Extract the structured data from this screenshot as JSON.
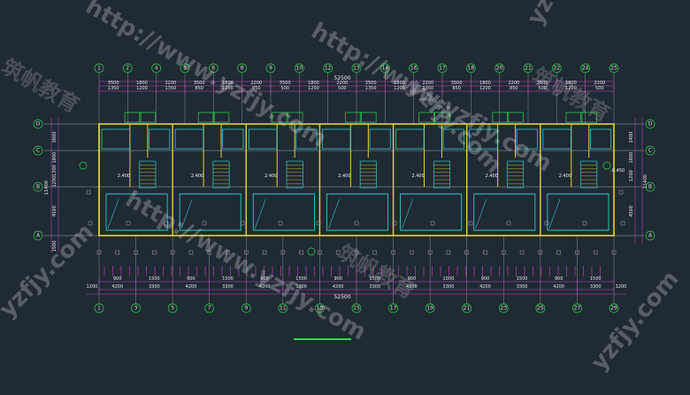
{
  "drawing": {
    "top_axes": [
      "1",
      "2",
      "4",
      "5",
      "6",
      "8",
      "9",
      "10",
      "12",
      "13",
      "14",
      "16",
      "17",
      "18",
      "20",
      "21",
      "22",
      "24",
      "25"
    ],
    "bottom_axes": [
      "1",
      "3",
      "5",
      "7",
      "9",
      "11",
      "13",
      "15",
      "17",
      "19",
      "21",
      "23",
      "25",
      "27",
      "29"
    ],
    "side_axes": [
      "D",
      "C",
      "B",
      "A"
    ],
    "total_length": "52500",
    "top_bays": [
      "3500",
      "1800",
      "2200",
      "3500",
      "1800",
      "2200",
      "3500",
      "1800",
      "2200",
      "3500",
      "1800",
      "2200",
      "3500",
      "1800",
      "2200",
      "3500",
      "1800",
      "2200"
    ],
    "top_sub": [
      "1350",
      "1200",
      "1350",
      "850",
      "1200",
      "850",
      "500",
      "1200",
      "500",
      "1350",
      "1200",
      "1350",
      "850",
      "1200",
      "850",
      "500",
      "1200",
      "500"
    ],
    "bottom_bays": [
      "4200",
      "3300",
      "4200",
      "3300",
      "4200",
      "3300",
      "4200",
      "3300",
      "4200",
      "3300",
      "4200",
      "3300",
      "4200",
      "3300"
    ],
    "bottom_sub": [
      "900",
      "1500",
      "900",
      "1500",
      "900",
      "1500",
      "900",
      "1500",
      "900",
      "1500",
      "900",
      "1500",
      "900",
      "1500"
    ],
    "end_dims": [
      "1200",
      "1200"
    ],
    "left_dims": [
      "3600",
      "1800",
      "1300",
      "1200",
      "4500"
    ],
    "left_total": "11400",
    "right_dims": [
      "2400",
      "1800",
      "1200",
      "4500"
    ],
    "right_total": "11400",
    "bottom_extra": "1500",
    "elevation": "-0.450",
    "room_dims": [
      "850",
      "1800",
      "850"
    ],
    "stair_labels": [
      "UP",
      "DN"
    ],
    "watermark_url": "http://www.yzfjy.com",
    "watermark_url_short": "yzfjy.com",
    "watermark_cn": "筑帆教育",
    "colors": {
      "background": "#1f2a33",
      "wall": "#e6d23a",
      "axis": "#45c7c7",
      "dim": "#d040d0",
      "grid_line": "#a8a8a8",
      "bubble_green": "#2dd84a",
      "cyan": "#30c8d0"
    }
  }
}
